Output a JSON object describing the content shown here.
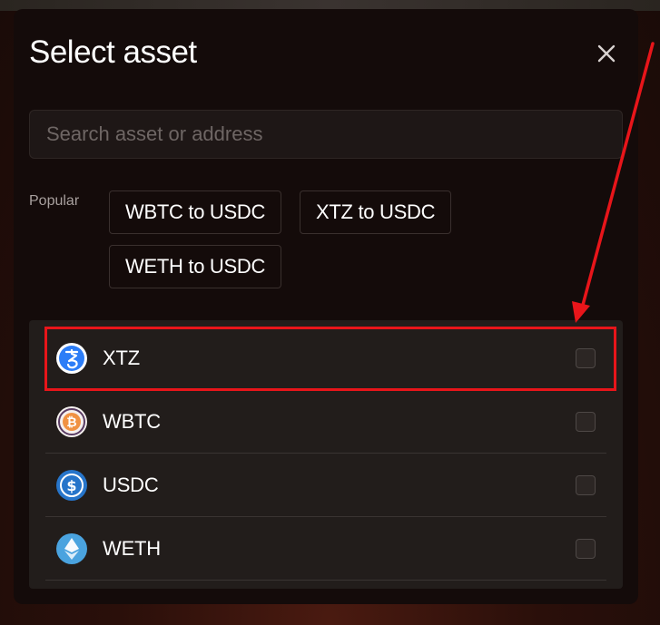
{
  "modal": {
    "title": "Select asset",
    "close_icon": "close-icon"
  },
  "search": {
    "placeholder": "Search asset or address",
    "value": ""
  },
  "popular": {
    "label": "Popular",
    "chips": [
      {
        "label": "WBTC to USDC"
      },
      {
        "label": "XTZ to USDC"
      },
      {
        "label": "WETH to USDC"
      }
    ]
  },
  "assets": [
    {
      "symbol": "XTZ",
      "icon": "tezos-icon",
      "checked": false
    },
    {
      "symbol": "WBTC",
      "icon": "wbtc-icon",
      "checked": false
    },
    {
      "symbol": "USDC",
      "icon": "usdc-icon",
      "checked": false
    },
    {
      "symbol": "WETH",
      "icon": "weth-icon",
      "checked": false
    }
  ],
  "annotation": {
    "color": "#e8151a",
    "target": "XTZ"
  },
  "colors": {
    "modal_bg": "#140b0a",
    "panel_bg": "#221d1b",
    "text": "#ffffff",
    "muted": "#a8a09e"
  }
}
